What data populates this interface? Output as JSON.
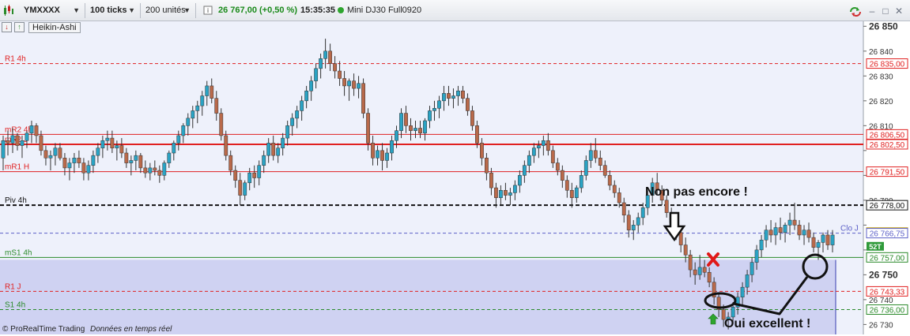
{
  "toolbar": {
    "symbol": "YMXXXX",
    "interval": "100 ticks",
    "units": "200 unités",
    "price_change": "26 767,00 (+0,50 %)",
    "time": "15:35:35",
    "instrument": "Mini DJ30 Full0920",
    "info_icon": "info-icon",
    "window_icons": [
      "refresh-icon",
      "minimize-icon",
      "restore-icon",
      "close-icon"
    ]
  },
  "subbar": {
    "mode_label": "Heikin-Ashi",
    "icons": [
      "down-arrow-icon",
      "up-arrow-icon"
    ]
  },
  "footer": {
    "brand": "© ProRealTime Trading",
    "status": "Données en temps réel"
  },
  "annotations": {
    "text_top": "Non pas encore !",
    "text_bottom": "Oui excellent !"
  },
  "colors": {
    "bull": "#2aa3c4",
    "bear": "#b9694a",
    "resistance": "#e02020",
    "support": "#2a8a2a",
    "pivot": "#111111",
    "zone": "#c9cdf0"
  },
  "chart_data": {
    "type": "candlestick",
    "style": "Heikin-Ashi",
    "ylim": [
      26726,
      26852
    ],
    "y_ticks": [
      26730,
      26740,
      26750,
      26760,
      26770,
      26780,
      26790,
      26800,
      26810,
      26820,
      26830,
      26840,
      26850
    ],
    "y_tick_labels": [
      "26 730",
      "26 740",
      "26 750",
      "",
      "",
      "26 780",
      "",
      "",
      "26 810",
      "26 820",
      "26 830",
      "26 840",
      "26 850"
    ],
    "bold_ticks": [
      26750,
      26850
    ],
    "levels": [
      {
        "name": "R1 4h",
        "value": 26835.0,
        "label": "26 835,00",
        "color": "#e02020",
        "style": "dashed"
      },
      {
        "name": "mR2 4h",
        "value": 26806.5,
        "label": "26 806,50",
        "color": "#e02020",
        "style": "solid"
      },
      {
        "name": "mR2 J",
        "value": 26802.5,
        "label": "26 802,50",
        "color": "#e02020",
        "style": "solid-thick"
      },
      {
        "name": "mR1 H",
        "value": 26791.5,
        "label": "26 791,50",
        "color": "#e02020",
        "style": "solid"
      },
      {
        "name": "Piv 4h",
        "value": 26778.0,
        "label": "26 778,00",
        "color": "#111111",
        "style": "dashed-thick"
      },
      {
        "name": "",
        "value": 26767.0,
        "label": "26 767,00",
        "color": "#222222",
        "style": "price"
      },
      {
        "name": "Clo J",
        "value": 26766.75,
        "label": "26 766,75",
        "color": "#5b5fc7",
        "style": "dashed"
      },
      {
        "name": "mS1 4h",
        "value": 26757.0,
        "label": "26 757,00",
        "color": "#2a8a2a",
        "style": "solid"
      },
      {
        "name": "R1 J",
        "value": 26743.33,
        "label": "26 743,33",
        "color": "#e02020",
        "style": "dashed"
      },
      {
        "name": "S1 4h",
        "value": 26736.0,
        "label": "26 736,00",
        "color": "#2a8a2a",
        "style": "dashed"
      }
    ],
    "tick_badge": "52T",
    "zone": {
      "from": 26726,
      "to": 26756
    },
    "candles": [
      [
        26797,
        26806,
        26792,
        26804
      ],
      [
        26804,
        26808,
        26798,
        26803
      ],
      [
        26803,
        26809,
        26799,
        26806
      ],
      [
        26806,
        26807,
        26800,
        26802
      ],
      [
        26802,
        26806,
        26797,
        26804
      ],
      [
        26804,
        26808,
        26801,
        26807
      ],
      [
        26807,
        26812,
        26803,
        26810
      ],
      [
        26810,
        26811,
        26803,
        26806
      ],
      [
        26806,
        26808,
        26798,
        26800
      ],
      [
        26800,
        26802,
        26794,
        26797
      ],
      [
        26797,
        26800,
        26792,
        26798
      ],
      [
        26798,
        26803,
        26794,
        26801
      ],
      [
        26801,
        26803,
        26796,
        26797
      ],
      [
        26797,
        26799,
        26790,
        26793
      ],
      [
        26793,
        26797,
        26788,
        26795
      ],
      [
        26795,
        26799,
        26791,
        26797
      ],
      [
        26797,
        26800,
        26793,
        26795
      ],
      [
        26795,
        26797,
        26788,
        26791
      ],
      [
        26791,
        26796,
        26788,
        26794
      ],
      [
        26794,
        26800,
        26791,
        26798
      ],
      [
        26798,
        26803,
        26795,
        26801
      ],
      [
        26801,
        26806,
        26797,
        26804
      ],
      [
        26804,
        26808,
        26800,
        26805
      ],
      [
        26805,
        26808,
        26799,
        26801
      ],
      [
        26801,
        26804,
        26796,
        26802
      ],
      [
        26802,
        26805,
        26797,
        26799
      ],
      [
        26799,
        26801,
        26793,
        26795
      ],
      [
        26795,
        26798,
        26790,
        26796
      ],
      [
        26796,
        26800,
        26792,
        26798
      ],
      [
        26798,
        26799,
        26791,
        26793
      ],
      [
        26793,
        26796,
        26789,
        26791
      ],
      [
        26791,
        26795,
        26788,
        26793
      ],
      [
        26793,
        26796,
        26790,
        26792
      ],
      [
        26792,
        26794,
        26787,
        26790
      ],
      [
        26790,
        26796,
        26788,
        26795
      ],
      [
        26795,
        26800,
        26793,
        26799
      ],
      [
        26799,
        26804,
        26796,
        26803
      ],
      [
        26803,
        26808,
        26800,
        26806
      ],
      [
        26806,
        26811,
        26803,
        26810
      ],
      [
        26810,
        26815,
        26806,
        26813
      ],
      [
        26813,
        26818,
        26809,
        26816
      ],
      [
        26816,
        26820,
        26811,
        26818
      ],
      [
        26818,
        26824,
        26814,
        26822
      ],
      [
        26822,
        26828,
        26818,
        26826
      ],
      [
        26826,
        26829,
        26819,
        26821
      ],
      [
        26821,
        26824,
        26812,
        26815
      ],
      [
        26815,
        26817,
        26804,
        26806
      ],
      [
        26806,
        26808,
        26796,
        26798
      ],
      [
        26798,
        26800,
        26790,
        26792
      ],
      [
        26792,
        26794,
        26785,
        26788
      ],
      [
        26788,
        26791,
        26778,
        26782
      ],
      [
        26782,
        26788,
        26780,
        26787
      ],
      [
        26787,
        26793,
        26784,
        26791
      ],
      [
        26791,
        26794,
        26785,
        26789
      ],
      [
        26789,
        26796,
        26786,
        26794
      ],
      [
        26794,
        26800,
        26791,
        26798
      ],
      [
        26798,
        26805,
        26795,
        26803
      ],
      [
        26803,
        26806,
        26796,
        26798
      ],
      [
        26798,
        26803,
        26795,
        26801
      ],
      [
        26801,
        26807,
        26798,
        26805
      ],
      [
        26805,
        26812,
        26802,
        26810
      ],
      [
        26810,
        26815,
        26806,
        26813
      ],
      [
        26813,
        26818,
        26809,
        26816
      ],
      [
        26816,
        26822,
        26812,
        26820
      ],
      [
        26820,
        26826,
        26817,
        26824
      ],
      [
        26824,
        26830,
        26820,
        26828
      ],
      [
        26828,
        26835,
        26825,
        26833
      ],
      [
        26833,
        26839,
        26829,
        26837
      ],
      [
        26837,
        26845,
        26833,
        26840
      ],
      [
        26840,
        26843,
        26832,
        26835
      ],
      [
        26835,
        26838,
        26829,
        26832
      ],
      [
        26832,
        26836,
        26826,
        26829
      ],
      [
        26829,
        26832,
        26822,
        26826
      ],
      [
        26826,
        26829,
        26820,
        26828
      ],
      [
        26828,
        26831,
        26822,
        26825
      ],
      [
        26825,
        26830,
        26821,
        26827
      ],
      [
        26827,
        26829,
        26813,
        26815
      ],
      [
        26815,
        26817,
        26800,
        26803
      ],
      [
        26803,
        26806,
        26794,
        26797
      ],
      [
        26797,
        26802,
        26794,
        26800
      ],
      [
        26800,
        26803,
        26792,
        26796
      ],
      [
        26796,
        26801,
        26793,
        26799
      ],
      [
        26799,
        26806,
        26796,
        26804
      ],
      [
        26804,
        26810,
        26801,
        26808
      ],
      [
        26808,
        26817,
        26805,
        26815
      ],
      [
        26815,
        26818,
        26807,
        26810
      ],
      [
        26810,
        26813,
        26804,
        26808
      ],
      [
        26808,
        26812,
        26805,
        26809
      ],
      [
        26809,
        26812,
        26805,
        26807
      ],
      [
        26807,
        26813,
        26804,
        26812
      ],
      [
        26812,
        26818,
        26809,
        26816
      ],
      [
        26816,
        26820,
        26812,
        26817
      ],
      [
        26817,
        26822,
        26813,
        26820
      ],
      [
        26820,
        26826,
        26816,
        26823
      ],
      [
        26823,
        26826,
        26818,
        26821
      ],
      [
        26821,
        26825,
        26817,
        26822
      ],
      [
        26822,
        26826,
        26818,
        26824
      ],
      [
        26824,
        26826,
        26819,
        26821
      ],
      [
        26821,
        26823,
        26814,
        26816
      ],
      [
        26816,
        26818,
        26808,
        26810
      ],
      [
        26810,
        26812,
        26801,
        26803
      ],
      [
        26803,
        26805,
        26794,
        26797
      ],
      [
        26797,
        26799,
        26788,
        26791
      ],
      [
        26791,
        26793,
        26782,
        26785
      ],
      [
        26785,
        26787,
        26777,
        26781
      ],
      [
        26781,
        26786,
        26778,
        26784
      ],
      [
        26784,
        26787,
        26780,
        26782
      ],
      [
        26782,
        26785,
        26778,
        26783
      ],
      [
        26783,
        26788,
        26780,
        26786
      ],
      [
        26786,
        26792,
        26783,
        26790
      ],
      [
        26790,
        26796,
        26787,
        26794
      ],
      [
        26794,
        26800,
        26791,
        26798
      ],
      [
        26798,
        26803,
        26795,
        26801
      ],
      [
        26801,
        26804,
        26797,
        26802
      ],
      [
        26802,
        26806,
        26798,
        26804
      ],
      [
        26804,
        26807,
        26798,
        26800
      ],
      [
        26800,
        26802,
        26793,
        26795
      ],
      [
        26795,
        26797,
        26790,
        26792
      ],
      [
        26792,
        26794,
        26785,
        26788
      ],
      [
        26788,
        26790,
        26781,
        26784
      ],
      [
        26784,
        26787,
        26777,
        26781
      ],
      [
        26781,
        26786,
        26779,
        26785
      ],
      [
        26785,
        26792,
        26783,
        26790
      ],
      [
        26790,
        26798,
        26788,
        26796
      ],
      [
        26796,
        26803,
        26793,
        26800
      ],
      [
        26800,
        26805,
        26795,
        26797
      ],
      [
        26797,
        26800,
        26792,
        26794
      ],
      [
        26794,
        26796,
        26789,
        26790
      ],
      [
        26790,
        26792,
        26784,
        26786
      ],
      [
        26786,
        26788,
        26781,
        26783
      ],
      [
        26783,
        26785,
        26777,
        26779
      ],
      [
        26779,
        26781,
        26771,
        26774
      ],
      [
        26774,
        26776,
        26765,
        26768
      ],
      [
        26768,
        26772,
        26764,
        26770
      ],
      [
        26770,
        26775,
        26767,
        26773
      ],
      [
        26773,
        26779,
        26770,
        26777
      ],
      [
        26777,
        26784,
        26774,
        26782
      ],
      [
        26782,
        26789,
        26779,
        26787
      ],
      [
        26787,
        26791,
        26782,
        26784
      ],
      [
        26784,
        26786,
        26778,
        26780
      ],
      [
        26780,
        26782,
        26773,
        26775
      ],
      [
        26775,
        26777,
        26768,
        26771
      ],
      [
        26771,
        26773,
        26764,
        26767
      ],
      [
        26767,
        26769,
        26759,
        26762
      ],
      [
        26762,
        26765,
        26755,
        26758
      ],
      [
        26758,
        26760,
        26749,
        26752
      ],
      [
        26752,
        26755,
        26746,
        26750
      ],
      [
        26750,
        26758,
        26748,
        26753
      ],
      [
        26753,
        26756,
        26749,
        26751
      ],
      [
        26751,
        26753,
        26745,
        26747
      ],
      [
        26747,
        26749,
        26738,
        26741
      ],
      [
        26741,
        26743,
        26733,
        26736
      ],
      [
        26736,
        26738,
        26729,
        26732
      ],
      [
        26732,
        26735,
        26728,
        26733
      ],
      [
        26733,
        26739,
        26731,
        26737
      ],
      [
        26737,
        26743,
        26734,
        26741
      ],
      [
        26741,
        26747,
        26738,
        26745
      ],
      [
        26745,
        26752,
        26742,
        26750
      ],
      [
        26750,
        26757,
        26747,
        26755
      ],
      [
        26755,
        26762,
        26752,
        26760
      ],
      [
        26760,
        26766,
        26757,
        26764
      ],
      [
        26764,
        26770,
        26761,
        26768
      ],
      [
        26768,
        26772,
        26763,
        26766
      ],
      [
        26766,
        26771,
        26762,
        26769
      ],
      [
        26769,
        26773,
        26764,
        26767
      ],
      [
        26767,
        26771,
        26763,
        26770
      ],
      [
        26770,
        26775,
        26766,
        26772
      ],
      [
        26772,
        26779,
        26768,
        26770
      ],
      [
        26770,
        26772,
        26764,
        26766
      ],
      [
        26766,
        26770,
        26762,
        26768
      ],
      [
        26768,
        26771,
        26763,
        26765
      ],
      [
        26765,
        26767,
        26759,
        26761
      ],
      [
        26761,
        26764,
        26756,
        26763
      ],
      [
        26763,
        26767,
        26759,
        26766
      ],
      [
        26766,
        26768,
        26760,
        26762
      ],
      [
        26762,
        26768,
        26759,
        26766
      ]
    ]
  }
}
